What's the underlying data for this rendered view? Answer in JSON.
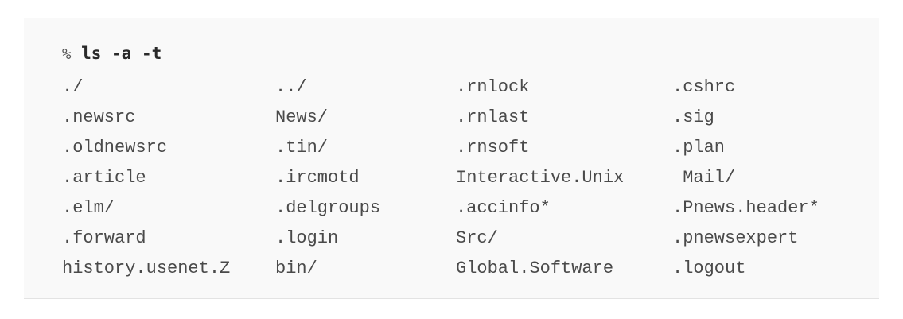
{
  "prompt": {
    "symbol": "%",
    "command": "ls -a -t"
  },
  "listing": {
    "rows": [
      [
        "./",
        "../",
        ".rnlock",
        ".cshrc"
      ],
      [
        ".newsrc",
        "News/",
        ".rnlast",
        ".sig"
      ],
      [
        ".oldnewsrc",
        ".tin/",
        ".rnsoft",
        ".plan"
      ],
      [
        ".article",
        ".ircmotd",
        "Interactive.Unix",
        " Mail/"
      ],
      [
        ".elm/",
        ".delgroups",
        ".accinfo*",
        ".Pnews.header*"
      ],
      [
        ".forward",
        ".login",
        "Src/",
        ".pnewsexpert"
      ],
      [
        "history.usenet.Z",
        "bin/",
        "Global.Software",
        ".logout"
      ]
    ]
  }
}
